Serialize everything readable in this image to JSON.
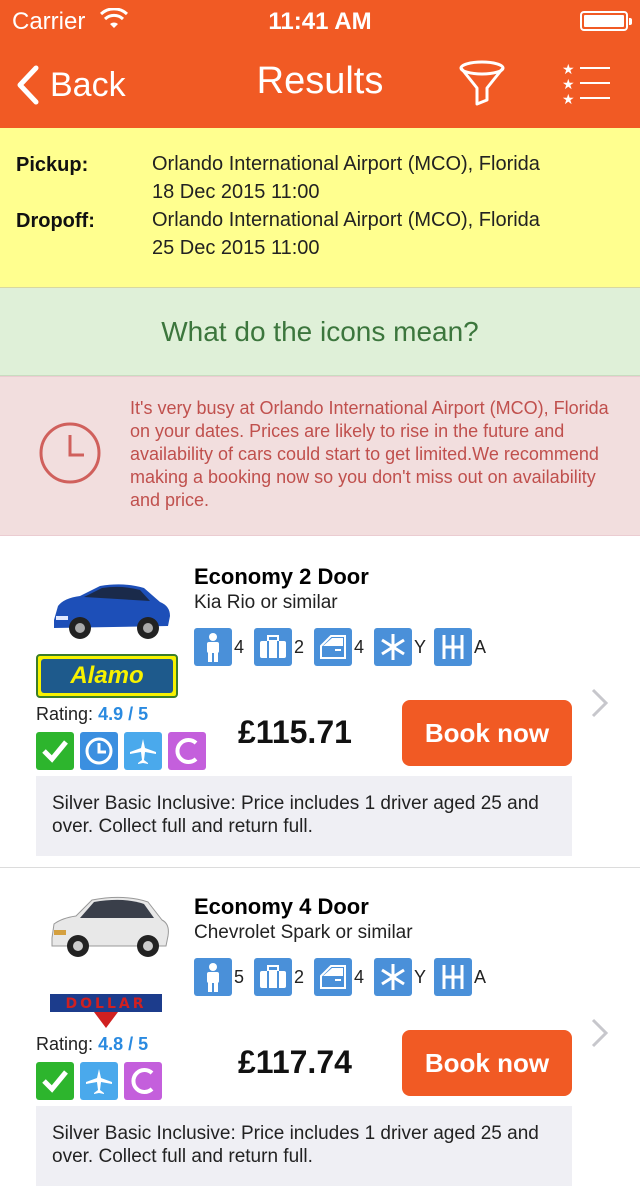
{
  "status_bar": {
    "carrier": "Carrier",
    "time": "11:41 AM"
  },
  "nav": {
    "back_label": "Back",
    "title": "Results"
  },
  "summary": {
    "pickup_label": "Pickup:",
    "pickup_location": "Orlando International Airport (MCO), Florida",
    "pickup_datetime": "18 Dec 2015 11:00",
    "dropoff_label": "Dropoff:",
    "dropoff_location": "Orlando International Airport (MCO), Florida",
    "dropoff_datetime": "25 Dec 2015 11:00"
  },
  "icons_link": "What do the icons mean?",
  "warning": "It's very busy at Orlando International Airport (MCO), Florida on your dates. Prices are likely to rise in the future and availability of cars could start to get limited.We recommend making a booking now so you don't miss out on availability and price.",
  "cars": [
    {
      "category": "Economy 2 Door",
      "model": "Kia Rio or similar",
      "supplier": "Alamo",
      "features": {
        "seats": "4",
        "bags": "2",
        "doors": "4",
        "aircon": "Y",
        "transmission": "A"
      },
      "rating_label": "Rating:",
      "rating": "4.9 / 5",
      "price": "£115.71",
      "book_label": "Book now",
      "inclusive": "Silver Basic Inclusive: Price includes 1 driver aged 25 and over. Collect full and return full.",
      "color": "#1d4fb8"
    },
    {
      "category": "Economy 4 Door",
      "model": "Chevrolet Spark or similar",
      "supplier": "DOLLAR",
      "features": {
        "seats": "5",
        "bags": "2",
        "doors": "4",
        "aircon": "Y",
        "transmission": "A"
      },
      "rating_label": "Rating:",
      "rating": "4.8 / 5",
      "price": "£117.74",
      "book_label": "Book now",
      "inclusive": "Silver Basic Inclusive: Price includes 1 driver aged 25 and over. Collect full and return full.",
      "color": "#e8e8e8"
    }
  ],
  "colors": {
    "brand": "#f15a24",
    "summary_bg": "#ffff8f",
    "info_bg": "#dff0d8",
    "warning_bg": "#f2dede",
    "rating": "#2a8ae0"
  }
}
